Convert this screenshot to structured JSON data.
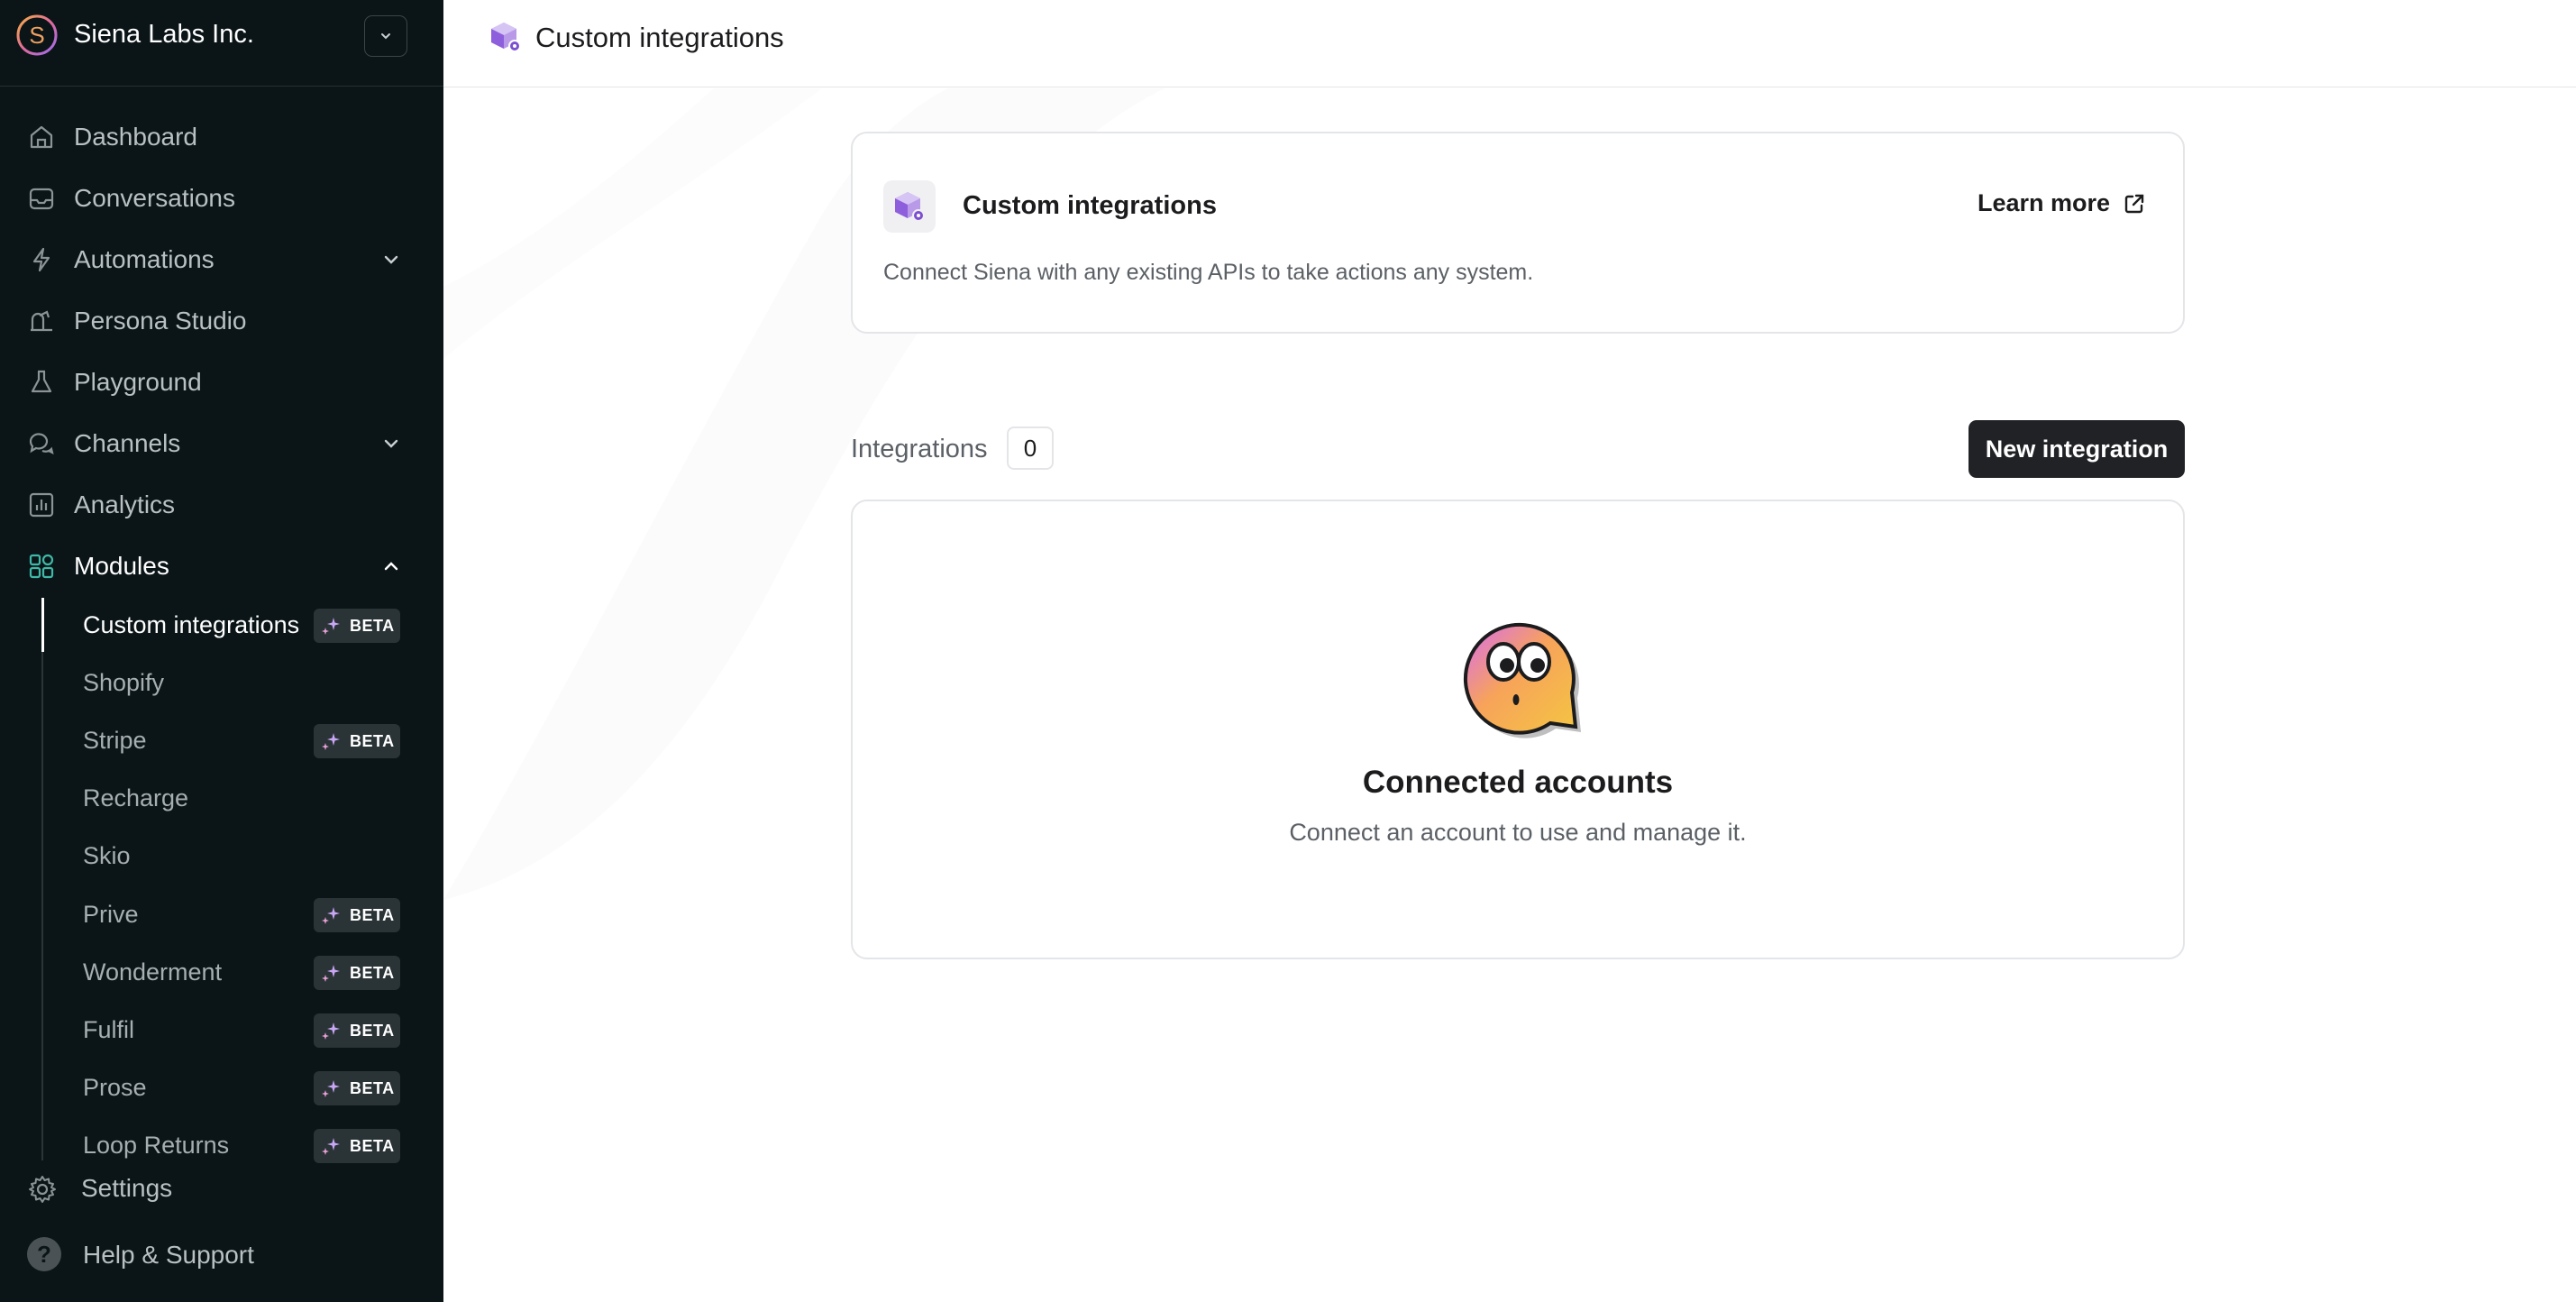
{
  "org": {
    "name": "Siena Labs Inc."
  },
  "nav": {
    "dashboard": "Dashboard",
    "conversations": "Conversations",
    "automations": "Automations",
    "persona_studio": "Persona Studio",
    "playground": "Playground",
    "channels": "Channels",
    "analytics": "Analytics",
    "modules": "Modules"
  },
  "modules": {
    "items": [
      {
        "label": "Custom integrations",
        "beta": true,
        "active": true
      },
      {
        "label": "Shopify",
        "beta": false
      },
      {
        "label": "Stripe",
        "beta": true
      },
      {
        "label": "Recharge",
        "beta": false
      },
      {
        "label": "Skio",
        "beta": false
      },
      {
        "label": "Prive",
        "beta": true
      },
      {
        "label": "Wonderment",
        "beta": true
      },
      {
        "label": "Fulfil",
        "beta": true
      },
      {
        "label": "Prose",
        "beta": true
      },
      {
        "label": "Loop Returns",
        "beta": true
      }
    ],
    "beta_label": "BETA"
  },
  "footer": {
    "settings": "Settings",
    "help": "Help & Support"
  },
  "header": {
    "title": "Custom integrations"
  },
  "info_card": {
    "title": "Custom integrations",
    "description": "Connect Siena with any existing APIs to take actions any system.",
    "learn_more": "Learn more"
  },
  "integrations": {
    "label": "Integrations",
    "count": "0",
    "new_button": "New integration"
  },
  "empty_state": {
    "title": "Connected accounts",
    "description": "Connect an account to use and manage it."
  },
  "colors": {
    "sidebar_bg": "#0b1517",
    "primary_button": "#212226",
    "accent_purple": "#7b4fd0",
    "modules_icon": "#3fb8a8"
  }
}
